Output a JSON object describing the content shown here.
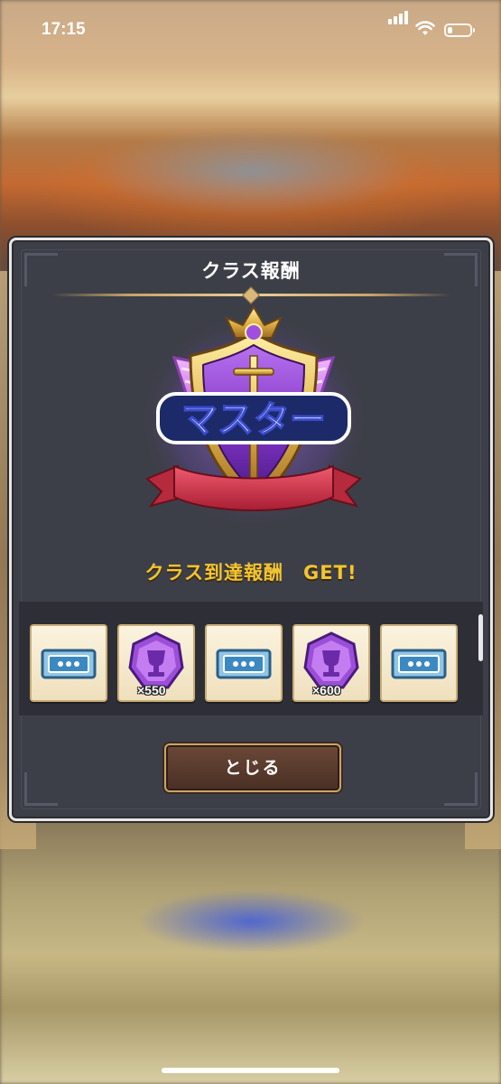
{
  "status_bar": {
    "time": "17:15",
    "battery_level": 0.22
  },
  "dialog": {
    "title": "クラス報酬",
    "rank_label": "マスター",
    "message": "クラス到達報酬　GET!",
    "rewards": [
      {
        "icon": "ticket-icon",
        "count": ""
      },
      {
        "icon": "purple-trophy-medal-icon",
        "count": "×550"
      },
      {
        "icon": "ticket-icon",
        "count": ""
      },
      {
        "icon": "purple-trophy-medal-icon",
        "count": "×600"
      },
      {
        "icon": "ticket-icon",
        "count": ""
      }
    ],
    "close_label": "とじる"
  },
  "colors": {
    "dialog_bg": "#3d3f48",
    "gold_text": "#f2c531",
    "emblem_purple": "#8a3fc7",
    "button_brown": "#5a3b2d"
  }
}
